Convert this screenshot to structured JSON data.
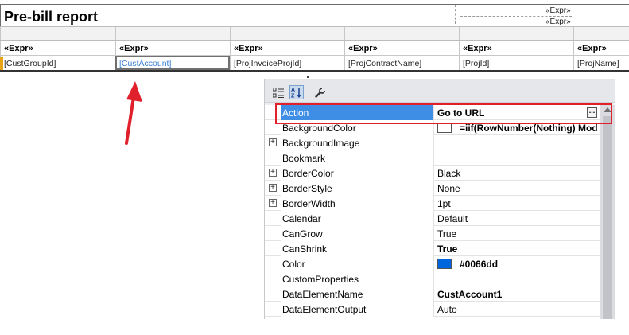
{
  "report": {
    "title": "Pre-bill report",
    "header_expr_1": "«Expr»",
    "header_expr_2": "«Expr»",
    "columns": [
      {
        "header": "«Expr»",
        "field": "[CustGroupId]"
      },
      {
        "header": "«Expr»",
        "field": "[CustAccount]"
      },
      {
        "header": "«Expr»",
        "field": "[ProjInvoiceProjId]"
      },
      {
        "header": "«Expr»",
        "field": "[ProjContractName]"
      },
      {
        "header": "«Expr»",
        "field": "[ProjId]"
      },
      {
        "header": "«Expr»",
        "field": "[ProjName]"
      }
    ],
    "selected_field": "[CustAccount]"
  },
  "properties": {
    "toolbar": {
      "categorized_icon": "categorized-list-icon",
      "alphabetical_icon": "sort-alphabetical-icon",
      "property_pages_icon": "wrench-icon",
      "alphabetical_label": "A↓"
    },
    "rows": [
      {
        "name": "Action",
        "value": "Go to URL",
        "expandable": false,
        "bold": true,
        "selected": true,
        "has_ellipsis": true
      },
      {
        "name": "BackgroundColor",
        "value": "=iif(RowNumber(Nothing) Mod",
        "expandable": false,
        "bold": true,
        "swatch": "#ffffff"
      },
      {
        "name": "BackgroundImage",
        "value": "",
        "expandable": true
      },
      {
        "name": "Bookmark",
        "value": "",
        "expandable": false
      },
      {
        "name": "BorderColor",
        "value": "Black",
        "expandable": true
      },
      {
        "name": "BorderStyle",
        "value": "None",
        "expandable": true
      },
      {
        "name": "BorderWidth",
        "value": "1pt",
        "expandable": true
      },
      {
        "name": "Calendar",
        "value": "Default",
        "expandable": false
      },
      {
        "name": "CanGrow",
        "value": "True",
        "expandable": false
      },
      {
        "name": "CanShrink",
        "value": "True",
        "expandable": false,
        "bold": true
      },
      {
        "name": "Color",
        "value": "#0066dd",
        "expandable": false,
        "bold": true,
        "swatch": "#0066dd"
      },
      {
        "name": "CustomProperties",
        "value": "",
        "expandable": false
      },
      {
        "name": "DataElementName",
        "value": "CustAccount1",
        "expandable": false,
        "bold": true
      },
      {
        "name": "DataElementOutput",
        "value": "Auto",
        "expandable": false
      }
    ],
    "expander_symbol": "+",
    "ellipsis_label": "..."
  },
  "colors": {
    "highlight": "#e0202a",
    "arrow": "#e0202a",
    "selection": "#3f8ee6",
    "row_marker": "#e8a317"
  }
}
